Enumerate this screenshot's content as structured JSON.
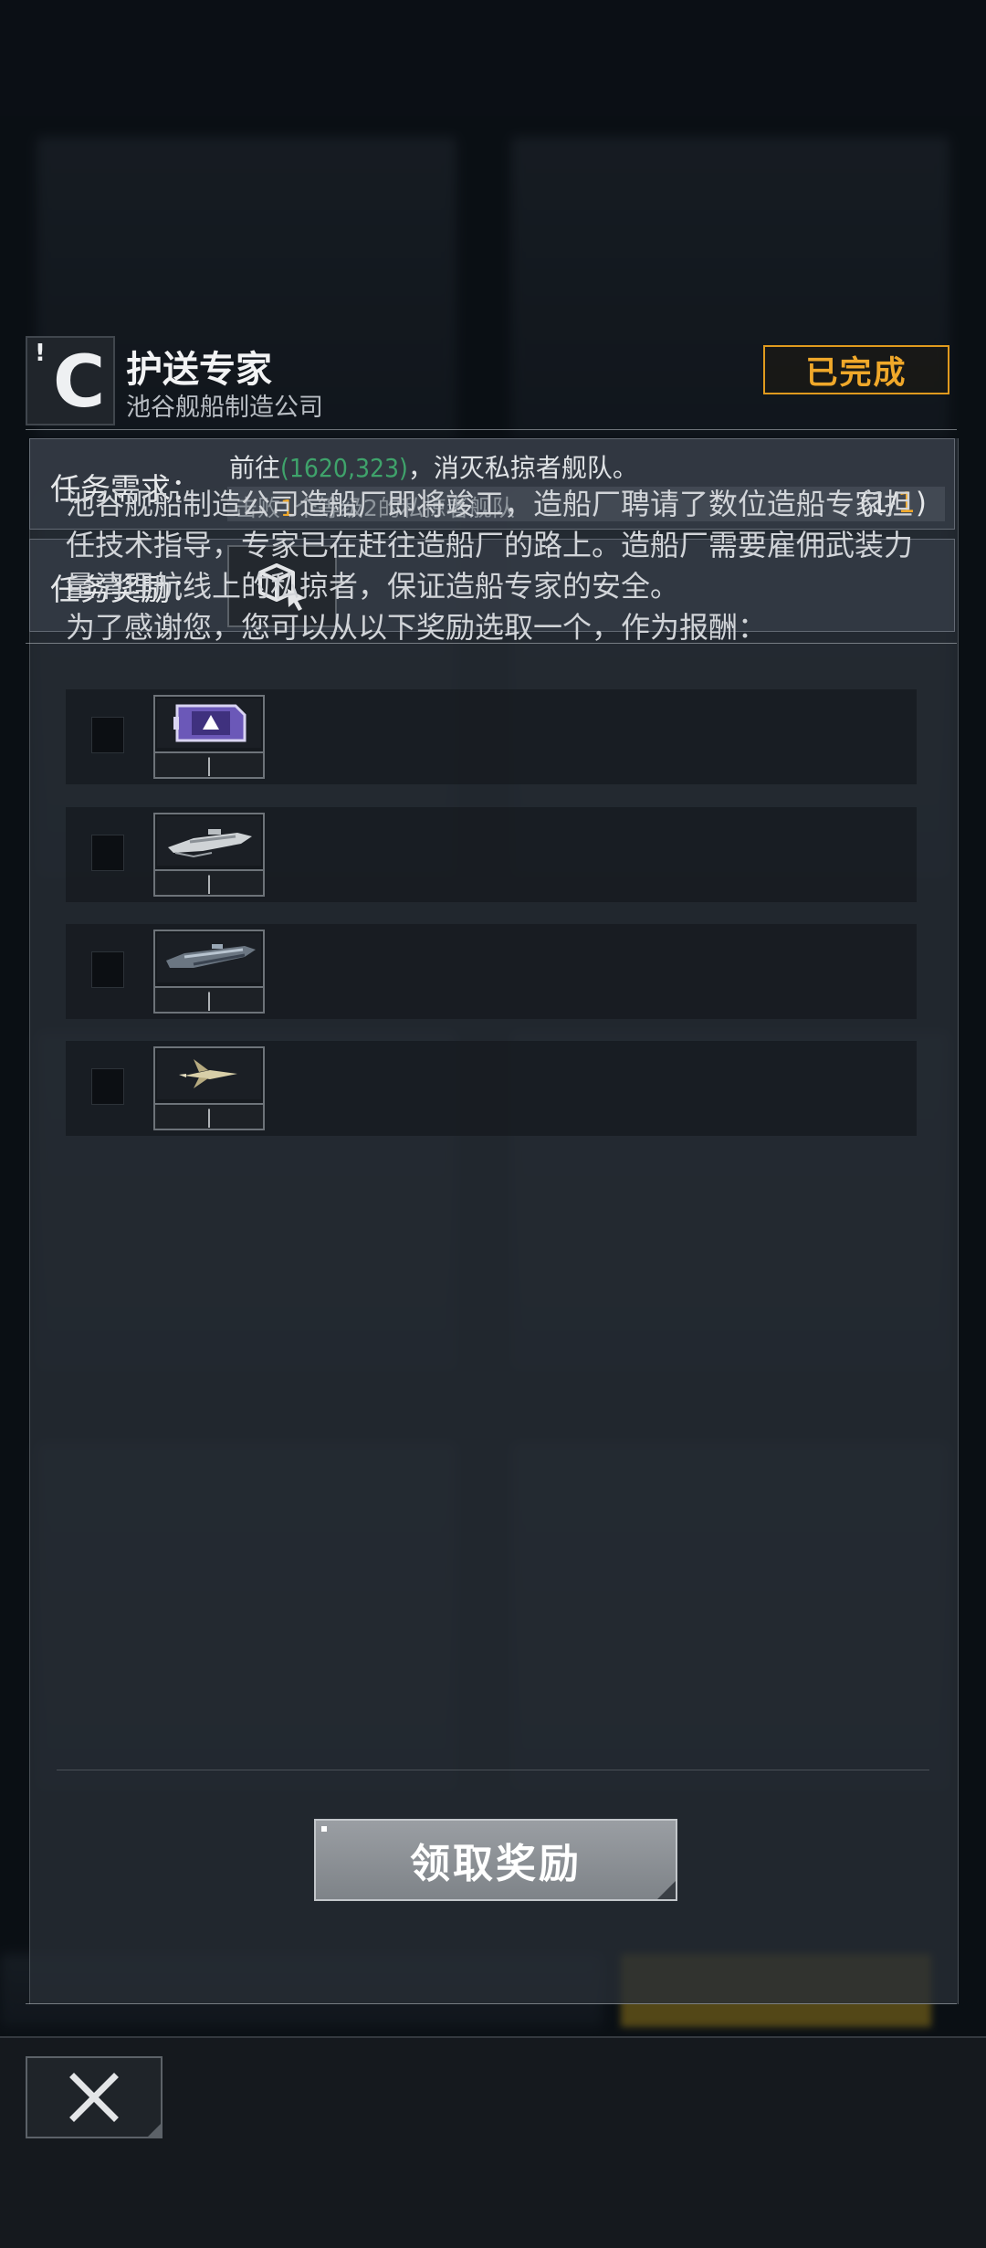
{
  "quest": {
    "title": "护送专家",
    "company": "池谷舰船制造公司",
    "status": "已完成",
    "logo_letter": "C",
    "logo_bang": "!"
  },
  "requirement": {
    "label": "任务需求：",
    "prefix": "前往",
    "coords": "(1620,323)",
    "suffix": "，消灭私掠者舰队。",
    "objective_pre": "击败",
    "objective_count": "1",
    "objective_post": "个等级2的私掠者舰队",
    "progress_open": "(1/",
    "progress_total": "1",
    "progress_close": ")"
  },
  "reward": {
    "label": "任务奖励：",
    "icon": "cube-cursor-icon"
  },
  "description": {
    "paragraph": "池谷舰船制造公司造船厂即将竣工，造船厂聘请了数位造船专家担任技术指导，专家已在赶往造船厂的路上。造船厂需要雇佣武装力量清理航线上的私掠者，保证造船专家的安全。",
    "choose": "为了感谢您，您可以从以下奖励选取一个，作为报酬："
  },
  "options": [
    {
      "item": "purple-module-icon",
      "count": "|"
    },
    {
      "item": "white-warship-icon",
      "count": "|"
    },
    {
      "item": "dark-cruiser-icon",
      "count": "|"
    },
    {
      "item": "gold-fighter-icon",
      "count": "|"
    }
  ],
  "claim_button": "领取奖励",
  "colors": {
    "accent_orange": "#f0a82a",
    "coords_green": "#3fa36b"
  }
}
